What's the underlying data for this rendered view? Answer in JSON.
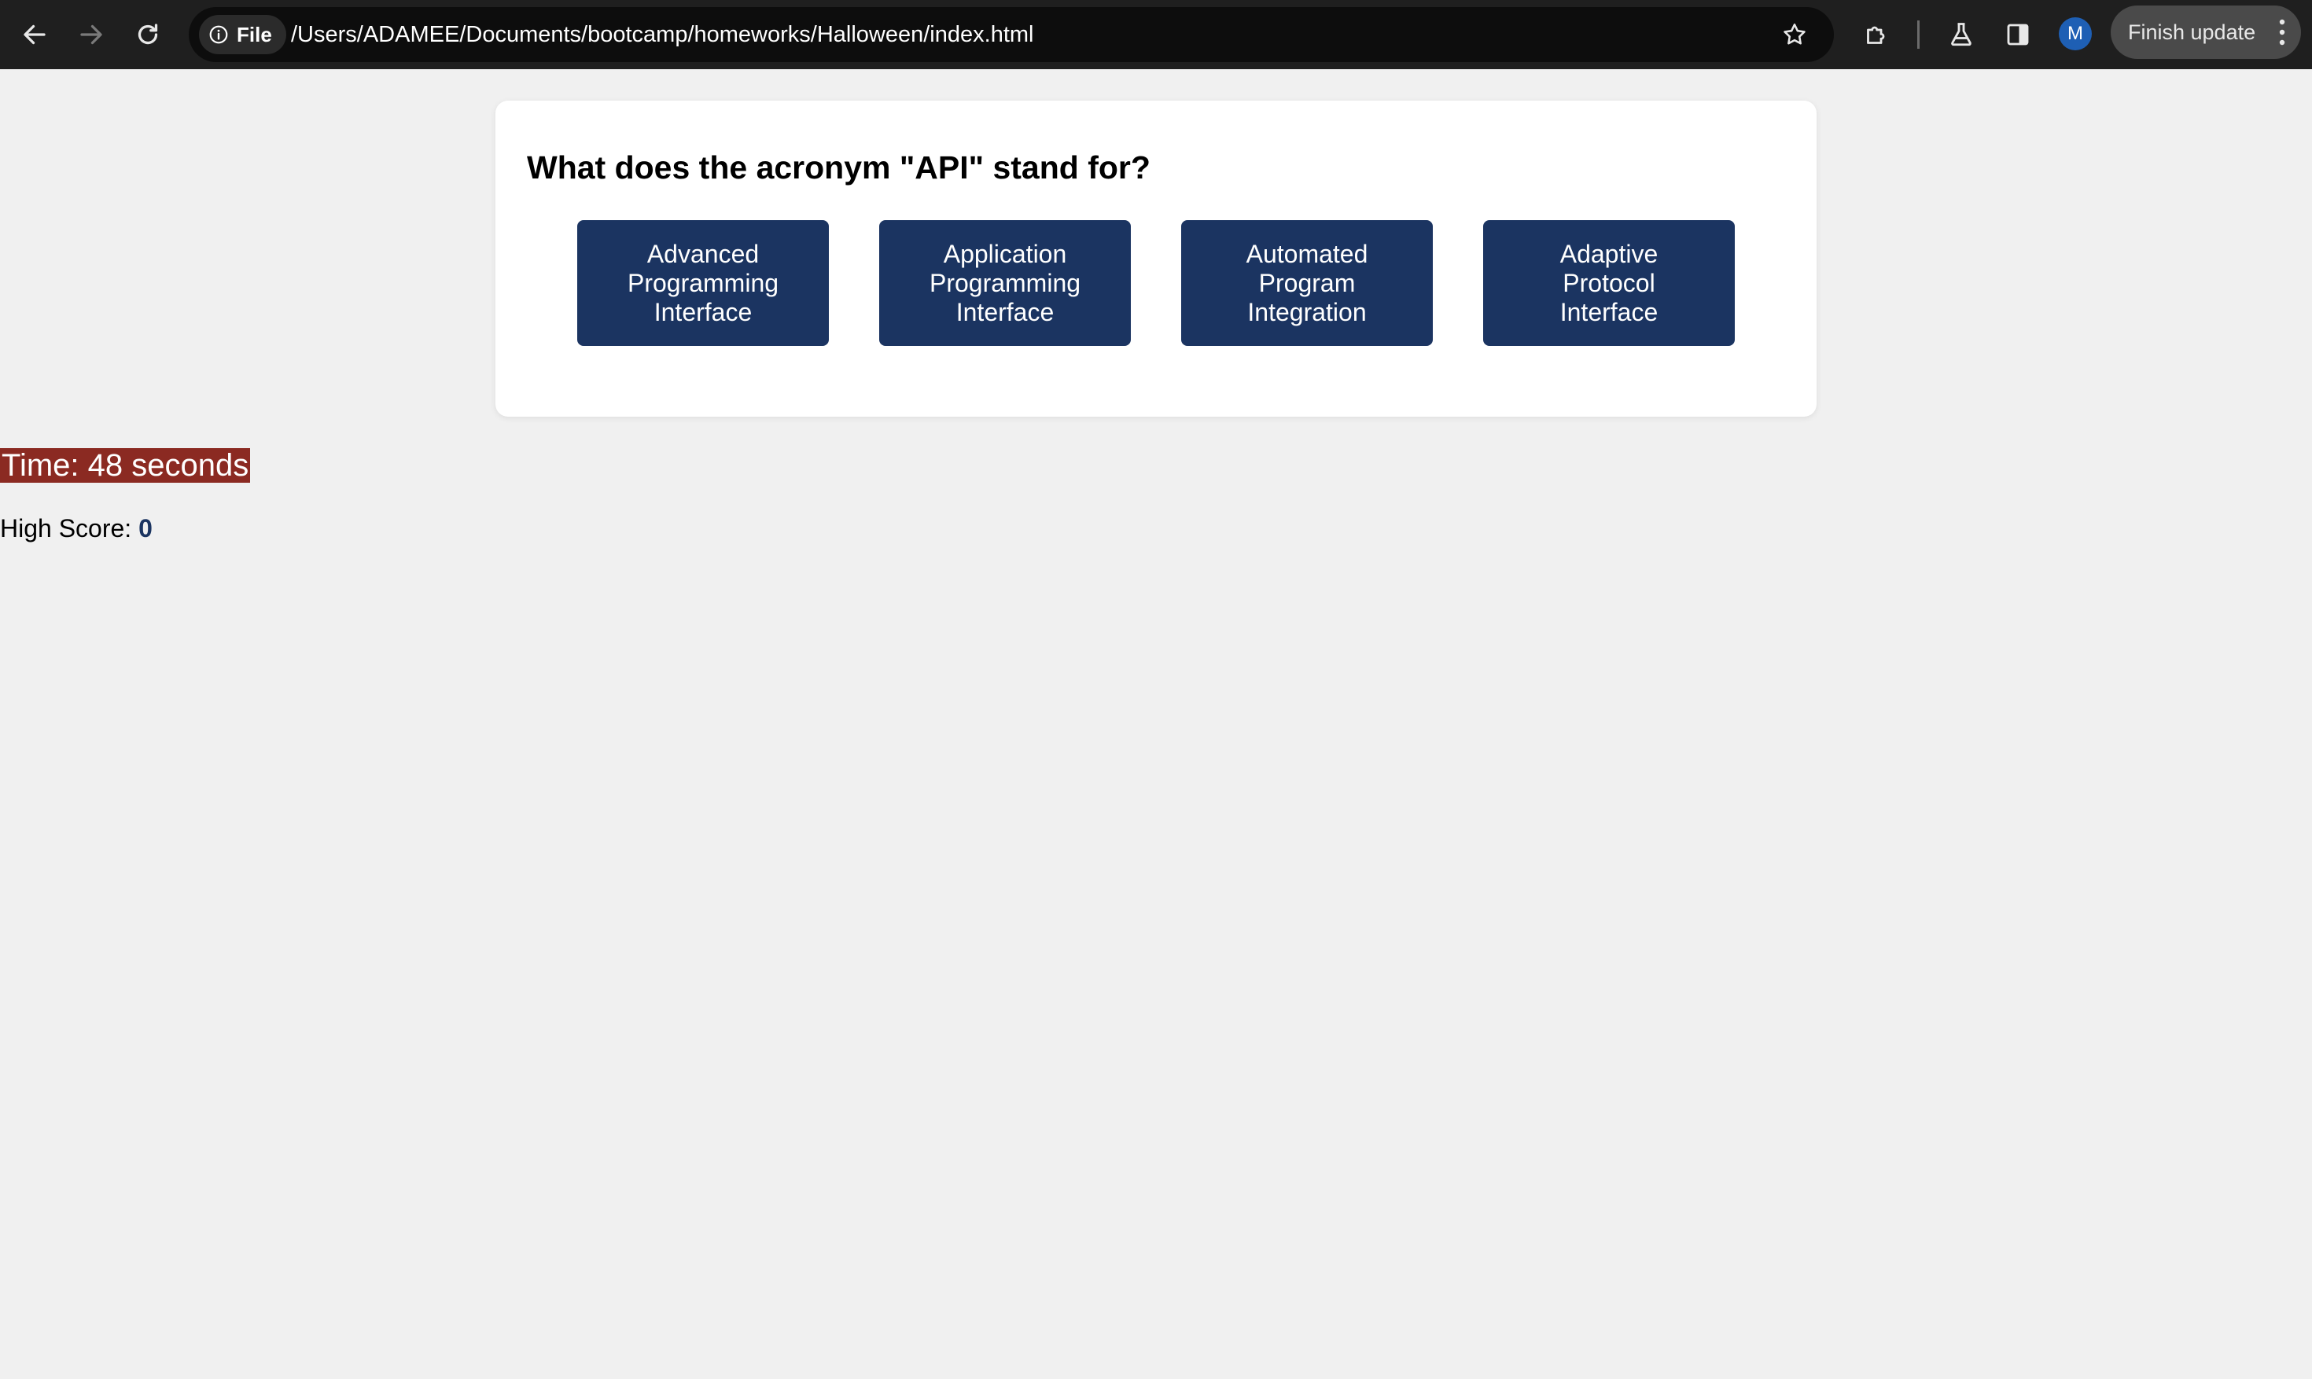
{
  "browser": {
    "file_chip_label": "File",
    "url": "/Users/ADAMEE/Documents/bootcamp/homeworks/Halloween/index.html",
    "profile_initial": "M",
    "finish_update_label": "Finish update"
  },
  "quiz": {
    "question": "What does the acronym \"API\" stand for?",
    "answers": [
      "Advanced Programming Interface",
      "Application Programming Interface",
      "Automated Program Integration",
      "Adaptive Protocol Interface"
    ]
  },
  "timer": {
    "text": "Time: 48 seconds"
  },
  "high_score": {
    "label": "High Score: ",
    "value": "0"
  },
  "colors": {
    "answer_button": "#1b3461",
    "timer_background": "#8b2a22",
    "page_background": "#f0f0f0"
  }
}
